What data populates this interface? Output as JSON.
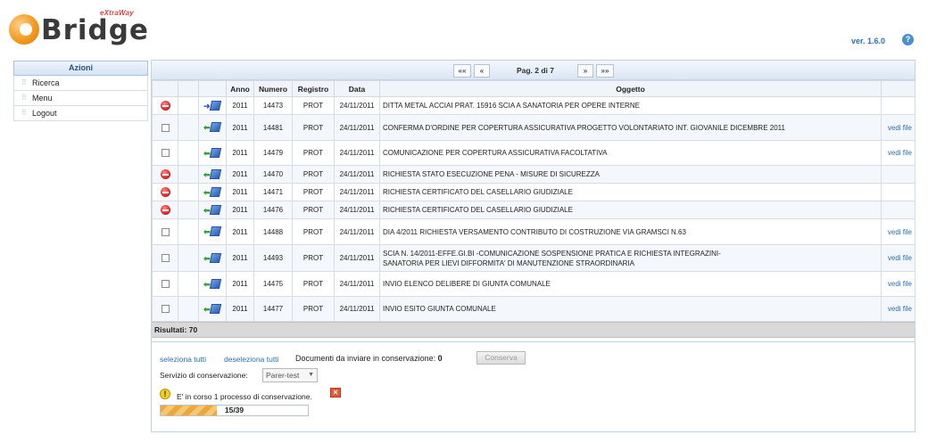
{
  "app": {
    "logo_word": "Bridge",
    "logo_sup": "eXtraWay",
    "version": "ver. 1.6.0",
    "help_symbol": "?"
  },
  "sidebar": {
    "title": "Azioni",
    "items": [
      {
        "label": "Ricerca"
      },
      {
        "label": "Menu"
      },
      {
        "label": "Logout"
      }
    ]
  },
  "pager": {
    "first": "««",
    "prev": "«",
    "label": "Pag. 2 di 7",
    "next": "»",
    "last": "»»"
  },
  "table": {
    "headers": [
      "",
      "",
      "",
      "Anno",
      "Numero",
      "Registro",
      "Data",
      "Oggetto",
      ""
    ],
    "rows": [
      {
        "action": "minus",
        "dir": "out",
        "anno": "2011",
        "numero": "14473",
        "registro": "PROT",
        "data": "24/11/2011",
        "oggetto": "DITTA METAL ACCIAI PRAT. 15916 SCIA A SANATORIA PER OPERE INTERNE",
        "link": ""
      },
      {
        "action": "checkbox",
        "dir": "in",
        "anno": "2011",
        "numero": "14481",
        "registro": "PROT",
        "data": "24/11/2011",
        "oggetto": "CONFERMA D'ORDINE PER COPERTURA ASSICURATIVA PROGETTO VOLONTARIATO INT. GIOVANILE DICEMBRE 2011",
        "link": "vedi file"
      },
      {
        "action": "checkbox",
        "dir": "in",
        "anno": "2011",
        "numero": "14479",
        "registro": "PROT",
        "data": "24/11/2011",
        "oggetto": "COMUNICAZIONE PER COPERTURA ASSICURATIVA FACOLTATIVA",
        "link": "vedi file"
      },
      {
        "action": "minus",
        "dir": "in",
        "anno": "2011",
        "numero": "14470",
        "registro": "PROT",
        "data": "24/11/2011",
        "oggetto": "RICHIESTA STATO ESECUZIONE PENA - MISURE DI SICUREZZA",
        "link": ""
      },
      {
        "action": "minus",
        "dir": "in",
        "anno": "2011",
        "numero": "14471",
        "registro": "PROT",
        "data": "24/11/2011",
        "oggetto": "RICHIESTA CERTIFICATO DEL CASELLARIO GIUDIZIALE",
        "link": ""
      },
      {
        "action": "minus",
        "dir": "in",
        "anno": "2011",
        "numero": "14476",
        "registro": "PROT",
        "data": "24/11/2011",
        "oggetto": "RICHIESTA CERTIFICATO DEL CASELLARIO GIUDIZIALE",
        "link": ""
      },
      {
        "action": "checkbox",
        "dir": "in",
        "anno": "2011",
        "numero": "14488",
        "registro": "PROT",
        "data": "24/11/2011",
        "oggetto": "DIA 4/2011 RICHIESTA VERSAMENTO CONTRIBUTO DI COSTRUZIONE VIA GRAMSCI N.63",
        "link": "vedi file"
      },
      {
        "action": "checkbox",
        "dir": "in",
        "anno": "2011",
        "numero": "14493",
        "registro": "PROT",
        "data": "24/11/2011",
        "oggetto": "SCIA N. 14/2011-EFFE.GI.BI -COMUNICAZIONE SOSPENSIONE PRATICA E RICHIESTA INTEGRAZINI-\nSANATORIA PER LIEVI DIFFORMITA' DI MANUTENZIONE STRAORDINARIA",
        "link": "vedi file"
      },
      {
        "action": "checkbox",
        "dir": "in",
        "anno": "2011",
        "numero": "14475",
        "registro": "PROT",
        "data": "24/11/2011",
        "oggetto": "INVIO ELENCO DELIBERE DI GIUNTA COMUNALE",
        "link": "vedi file"
      },
      {
        "action": "checkbox",
        "dir": "in",
        "anno": "2011",
        "numero": "14477",
        "registro": "PROT",
        "data": "24/11/2011",
        "oggetto": "INVIO ESITO GIUNTA COMUNALE",
        "link": "vedi file"
      }
    ]
  },
  "results": "Risultati: 70",
  "footer": {
    "select_all": "seleziona tutti",
    "deselect_all": "deseleziona tutti",
    "docs_label": "Documenti da inviare in conservazione:",
    "docs_count": "0",
    "conserva_button": "Conserva",
    "service_label": "Servizio di conservazione:",
    "service_value": "Parer-test",
    "warning_text": "E' in corso 1 processo di conservazione.",
    "progress_text": "15/39",
    "progress_done": 15,
    "progress_total": 39
  }
}
